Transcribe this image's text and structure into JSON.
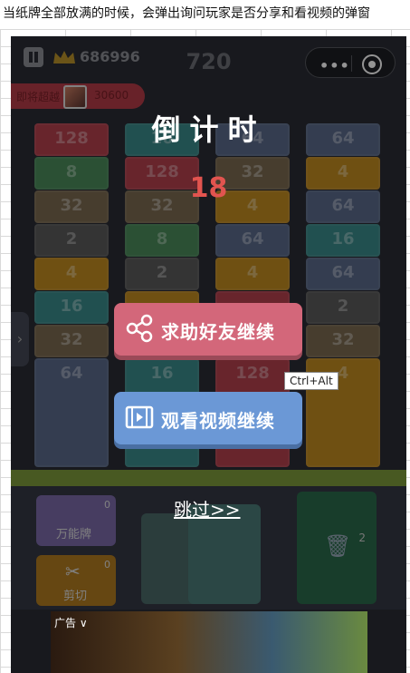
{
  "caption": "当纸牌全部放满的时候，会弹出询问玩家是否分享和看视频的弹窗",
  "header": {
    "best_score": "686996",
    "current_score": "720",
    "menu_dots": "•••",
    "rival_label": "即将超越",
    "rival_score": "30600"
  },
  "columns": [
    {
      "cards": [
        "128",
        "8",
        "32",
        "2",
        "4",
        "16",
        "32",
        "64"
      ],
      "colors": [
        "#b3404c",
        "#4a8a5a",
        "#7a6a50",
        "#5a5a5a",
        "#c08a20",
        "#3a8a8a",
        "#7a6a50",
        "#5a6a8a"
      ]
    },
    {
      "cards": [
        "16",
        "128",
        "32",
        "8",
        "2",
        "",
        "",
        "16"
      ],
      "colors": [
        "#3a8a8a",
        "#b3404c",
        "#7a6a50",
        "#4a8a5a",
        "#5a5a5a",
        "#c08a20",
        "#3a8a8a",
        "#3a8a8a"
      ]
    },
    {
      "cards": [
        "64",
        "32",
        "4",
        "64",
        "4",
        "",
        "",
        "128"
      ],
      "colors": [
        "#5a6a8a",
        "#7a6a50",
        "#c08a20",
        "#5a6a8a",
        "#c08a20",
        "#b3404c",
        "#5a5a5a",
        "#b3404c"
      ]
    },
    {
      "cards": [
        "64",
        "4",
        "64",
        "16",
        "64",
        "2",
        "32",
        "4"
      ],
      "colors": [
        "#5a6a8a",
        "#c08a20",
        "#5a6a8a",
        "#3a8a8a",
        "#5a6a8a",
        "#5a5a5a",
        "#7a6a50",
        "#c08a20"
      ]
    }
  ],
  "dialog": {
    "title": "倒计时",
    "countdown": "18",
    "share_label": "求助好友继续",
    "video_label": "观看视频继续",
    "skip_label": "跳过>>"
  },
  "tooltip": "Ctrl+Alt",
  "tools": {
    "wild_label": "万能牌",
    "wild_count": "0",
    "cut_label": "剪切",
    "cut_count": "0",
    "trash_count": "2"
  },
  "ad": {
    "tag": "广告 ∨"
  },
  "colors": {
    "accent_share": "#d3677a",
    "accent_video": "#6b98d6",
    "countdown": "#e2544f"
  }
}
